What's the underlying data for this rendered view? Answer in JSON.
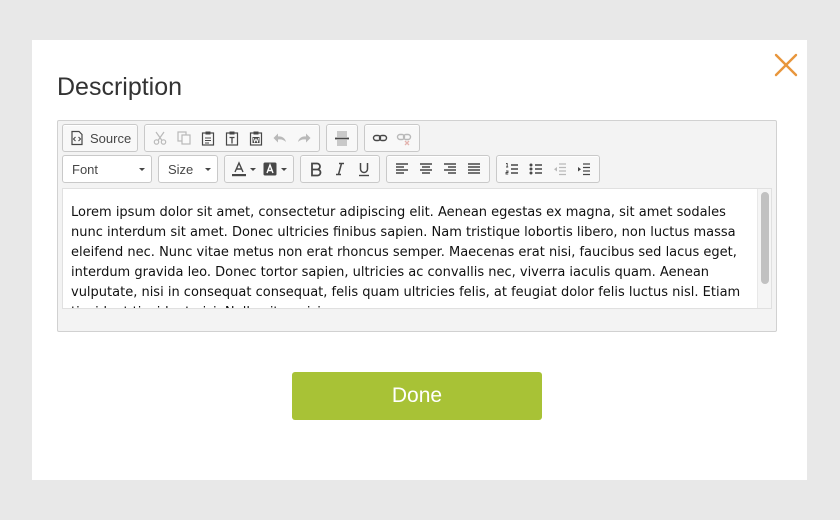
{
  "dialog": {
    "title": "Description",
    "done_label": "Done",
    "accent_close": "#e8963c",
    "accent_done": "#a8c236"
  },
  "toolbar": {
    "source_label": "Source",
    "font_combo": "Font",
    "size_combo": "Size"
  },
  "editor": {
    "content": "Lorem ipsum dolor sit amet, consectetur adipiscing elit. Aenean egestas ex magna, sit amet sodales nunc interdum sit amet. Donec ultricies finibus sapien. Nam tristique lobortis libero, non luctus massa eleifend nec. Nunc vitae metus non erat rhoncus semper. Maecenas erat nisi, faucibus sed lacus eget, interdum gravida leo. Donec tortor sapien, ultricies ac convallis nec, viverra iaculis quam. Aenean vulputate, nisi in consequat consequat, felis quam ultricies felis, at feugiat dolor felis luctus nisl. Etiam tincidunt tincidunt nisi. Nulla vitae nisi."
  }
}
